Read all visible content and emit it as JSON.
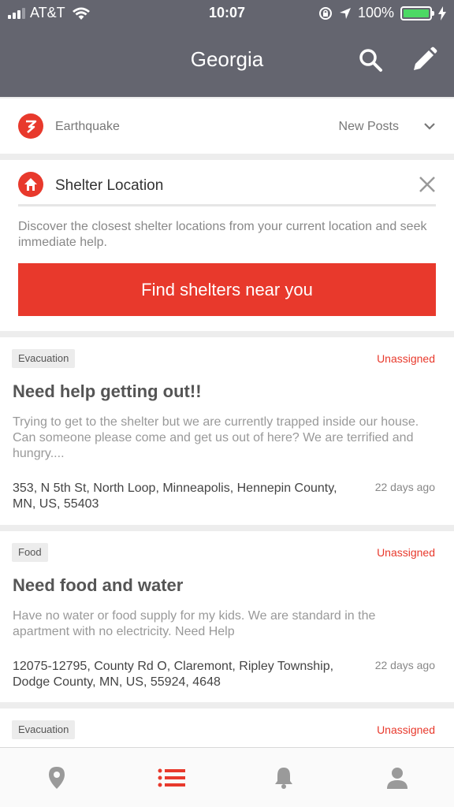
{
  "status_bar": {
    "carrier": "AT&T",
    "time": "10:07",
    "battery": "100%"
  },
  "header": {
    "title": "Georgia",
    "icons": [
      "search-icon",
      "edit-icon"
    ]
  },
  "disaster": {
    "label": "Earthquake",
    "filter": "New Posts"
  },
  "shelter": {
    "title": "Shelter Location",
    "description": "Discover the closest shelter locations from your current location and seek immediate help.",
    "button": "Find shelters near you"
  },
  "posts": [
    {
      "tag": "Evacuation",
      "status": "Unassigned",
      "title": "Need help getting out!!",
      "description": "Trying to get to the shelter but we are currently trapped inside our house. Can someone please come and get us out of here? We are terrified and hungry....",
      "address": "353, N 5th St, North Loop, Minneapolis, Hennepin County, MN, US, 55403",
      "time": "22 days ago"
    },
    {
      "tag": "Food",
      "status": "Unassigned",
      "title": "Need food and water",
      "description": "Have no water or food supply for my kids. We are standard in the apartment with no electricity. Need Help",
      "address": "12075-12795, County Rd O, Claremont, Ripley Township, Dodge County, MN, US, 55924, 4648",
      "time": "22 days ago"
    },
    {
      "tag": "Evacuation",
      "status": "Unassigned"
    }
  ],
  "tabbar": {
    "items": [
      "map-pin-icon",
      "list-icon",
      "bell-icon",
      "profile-icon"
    ],
    "active": "list-icon"
  },
  "colors": {
    "header": "#64656f",
    "accent": "#e8392c",
    "battery": "#4cd964"
  }
}
